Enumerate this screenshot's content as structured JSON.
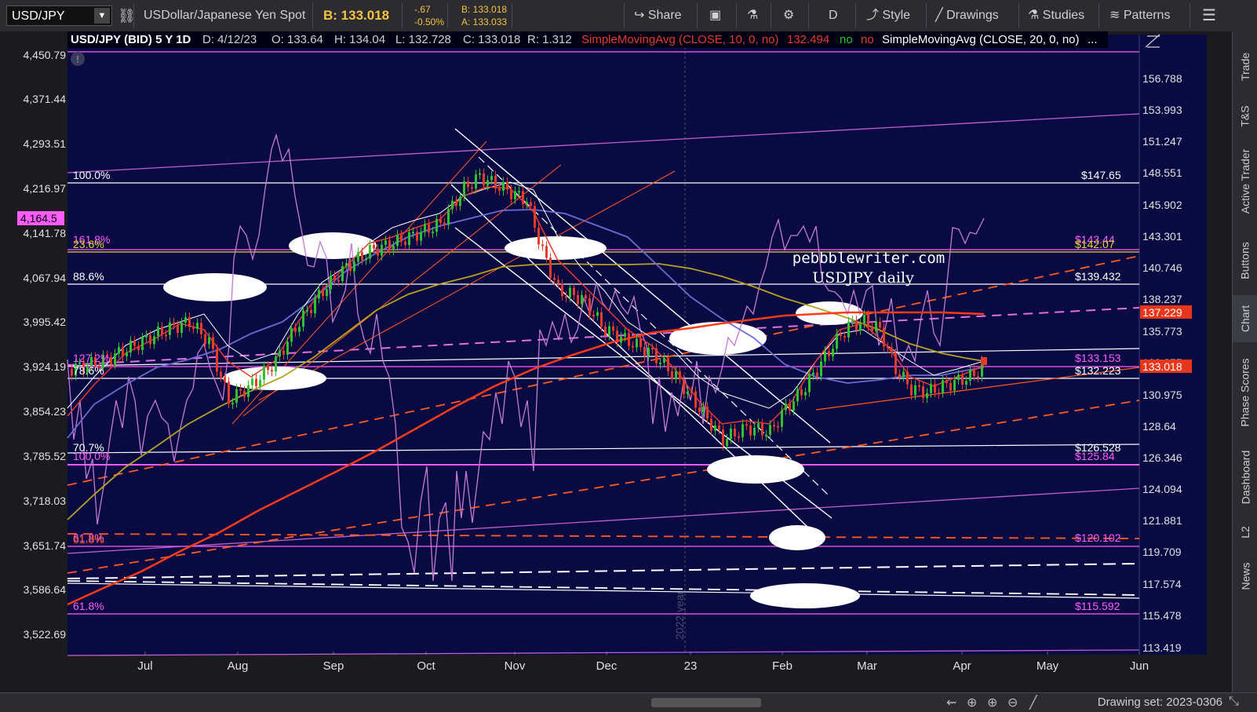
{
  "toolbar": {
    "symbol": "USD/JPY",
    "description": "USDollar/Japanese Yen Spot",
    "bid": "B: 133.018",
    "change": "-.67",
    "change_pct": "-0.50%",
    "bid_small": "B: 133.018",
    "ask_small": "A: 133.033",
    "share": "Share",
    "period": "D",
    "style": "Style",
    "drawings": "Drawings",
    "studies": "Studies",
    "patterns": "Patterns"
  },
  "header": {
    "title": "USD/JPY (BID) 5 Y 1D",
    "date": "D: 4/12/23",
    "open": "O: 133.64",
    "high": "H: 134.04",
    "low": "L: 132.728",
    "close": "C: 133.018",
    "range": "R: 1.312",
    "sma10": "SimpleMovingAvg (CLOSE, 10, 0, no)",
    "sma10_val": "132.494",
    "flag_no1": "no",
    "flag_no2": "no",
    "sma20": "SimpleMovingAvg (CLOSE, 20, 0, no)",
    "more": "..."
  },
  "watermark": {
    "line1": "pebbblewriter.com",
    "line2": "USDJPY daily",
    "year": "2022 year"
  },
  "left_axis": [
    "4,450.79",
    "4,371.44",
    "4,293.51",
    "4,216.97",
    "4,141.78",
    "4,067.94",
    "3,995.42",
    "3,924.19",
    "3,854.23",
    "3,785.52",
    "3,718.03",
    "3,651.74",
    "3,586.64",
    "3,522.69"
  ],
  "left_marker": "4,164.5",
  "right_axis": [
    "156.788",
    "153.993",
    "151.247",
    "148.551",
    "145.902",
    "143.301",
    "140.746",
    "138.237",
    "135.773",
    "133.355",
    "130.975",
    "128.64",
    "126.346",
    "124.094",
    "121.881",
    "119.709",
    "117.574",
    "115.478",
    "113.419"
  ],
  "right_markers": {
    "sma_red": "137.229",
    "price": "133.018"
  },
  "x_labels": [
    "Jul",
    "Aug",
    "Sep",
    "Oct",
    "Nov",
    "Dec",
    "23",
    "Feb",
    "Mar",
    "Apr",
    "May",
    "Jun"
  ],
  "fib_left": [
    "100.0%",
    "161.8%",
    "23.6%",
    "88.6%",
    "127.2%",
    "78.6%",
    "70.7%",
    "100.0%",
    "61.8%",
    "61.8%",
    "61.8%"
  ],
  "fib_right": [
    "$147.65",
    "$143.44",
    "$142.07",
    "$139.432",
    "$133.153",
    "$132.223",
    "$126.528",
    "$125.84",
    "$120.102",
    "$115.592"
  ],
  "right_tabs": [
    "Trade",
    "T&S",
    "Active Trader",
    "Buttons",
    "Chart",
    "Phase Scores",
    "Dashboard",
    "L2",
    "News"
  ],
  "bottom": {
    "drawing_set": "Drawing set: 2023-0306"
  },
  "colors": {
    "bg": "#0a0a42",
    "sma_red": "#ff3b1a",
    "sma_blue": "#6b6bd6",
    "sma_olive": "#b8a020",
    "rsi": "#c47ad6",
    "magenta": "#ff5cff",
    "up": "#2fc12f",
    "down": "#e53b2b"
  }
}
